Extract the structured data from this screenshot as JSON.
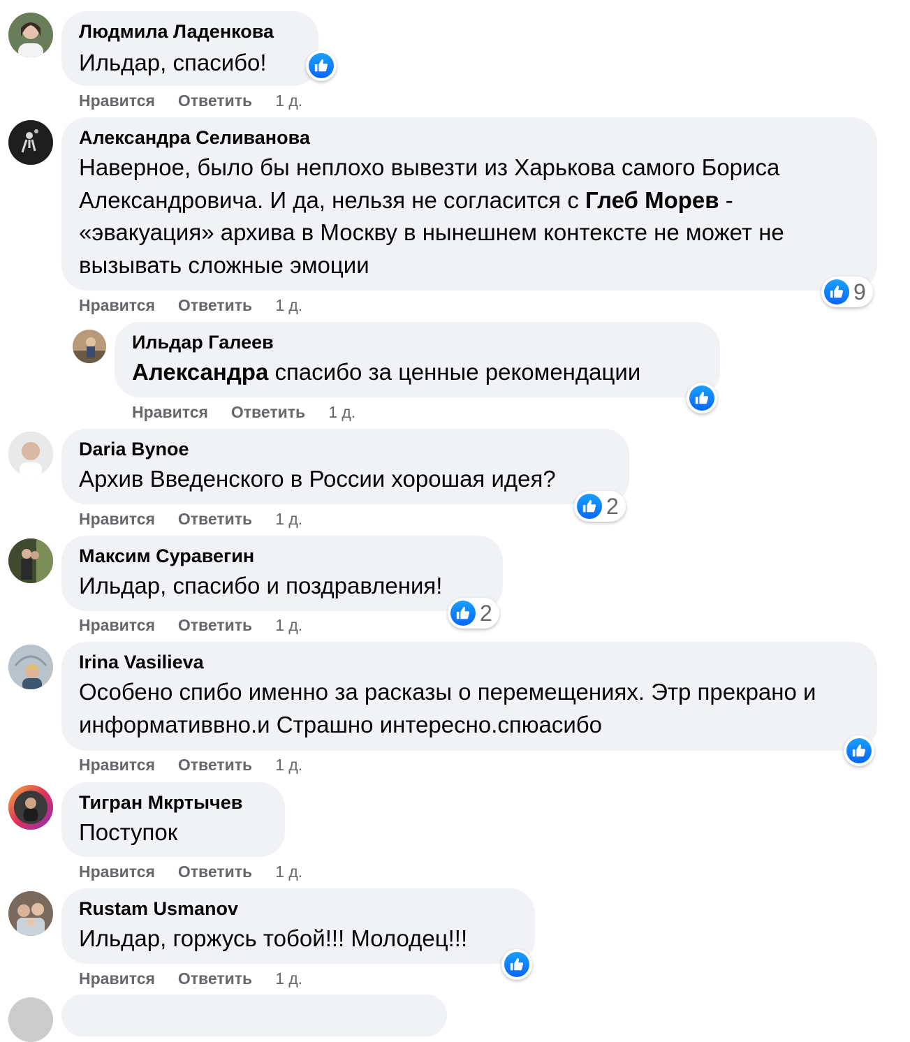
{
  "actions": {
    "like": "Нравится",
    "reply": "Ответить"
  },
  "comments": [
    {
      "author": "Людмила Ладенкова",
      "text": "Ильдар, спасибо!",
      "time": "1 д."
    },
    {
      "author": "Александра Селиванова",
      "text_parts": [
        "Наверное, было бы неплохо вывезти из Харькова самого Бориса Александровича. И да, нельзя не согласится с ",
        "Глеб Морев",
        " - «эвакуация» архива в Москву в нынешнем контексте не может не вызывать сложные эмоции"
      ],
      "reactions": "9",
      "time": "1 д."
    },
    {
      "author": "Ильдар Галеев",
      "mention": "Александра",
      "text": " спасибо за ценные рекомендации",
      "time": "1 д."
    },
    {
      "author": "Daria Bynoe",
      "text": "Архив Введенского в России хорошая идея?",
      "reactions": "2",
      "time": "1 д."
    },
    {
      "author": "Максим Суравегин",
      "text": "Ильдар, спасибо и поздравления!",
      "reactions": "2",
      "time": "1 д."
    },
    {
      "author": "Irina Vasilieva",
      "text": "Особено спибо именно за расказы о перемещениях. Этр прекрано и информативвно.и Страшно интересно.спюасибо",
      "time": "1 д."
    },
    {
      "author": "Тигран Мкртычев",
      "text": "Поступок",
      "time": "1 д."
    },
    {
      "author": "Rustam Usmanov",
      "text": "Ильдар, горжусь тобой!!! Молодец!!!",
      "time": "1 д."
    }
  ],
  "colors": {
    "like_blue": "#0866ff",
    "bubble": "#f0f2f5",
    "meta": "#65676b"
  },
  "icons": {
    "like": "thumbs-up-icon"
  }
}
